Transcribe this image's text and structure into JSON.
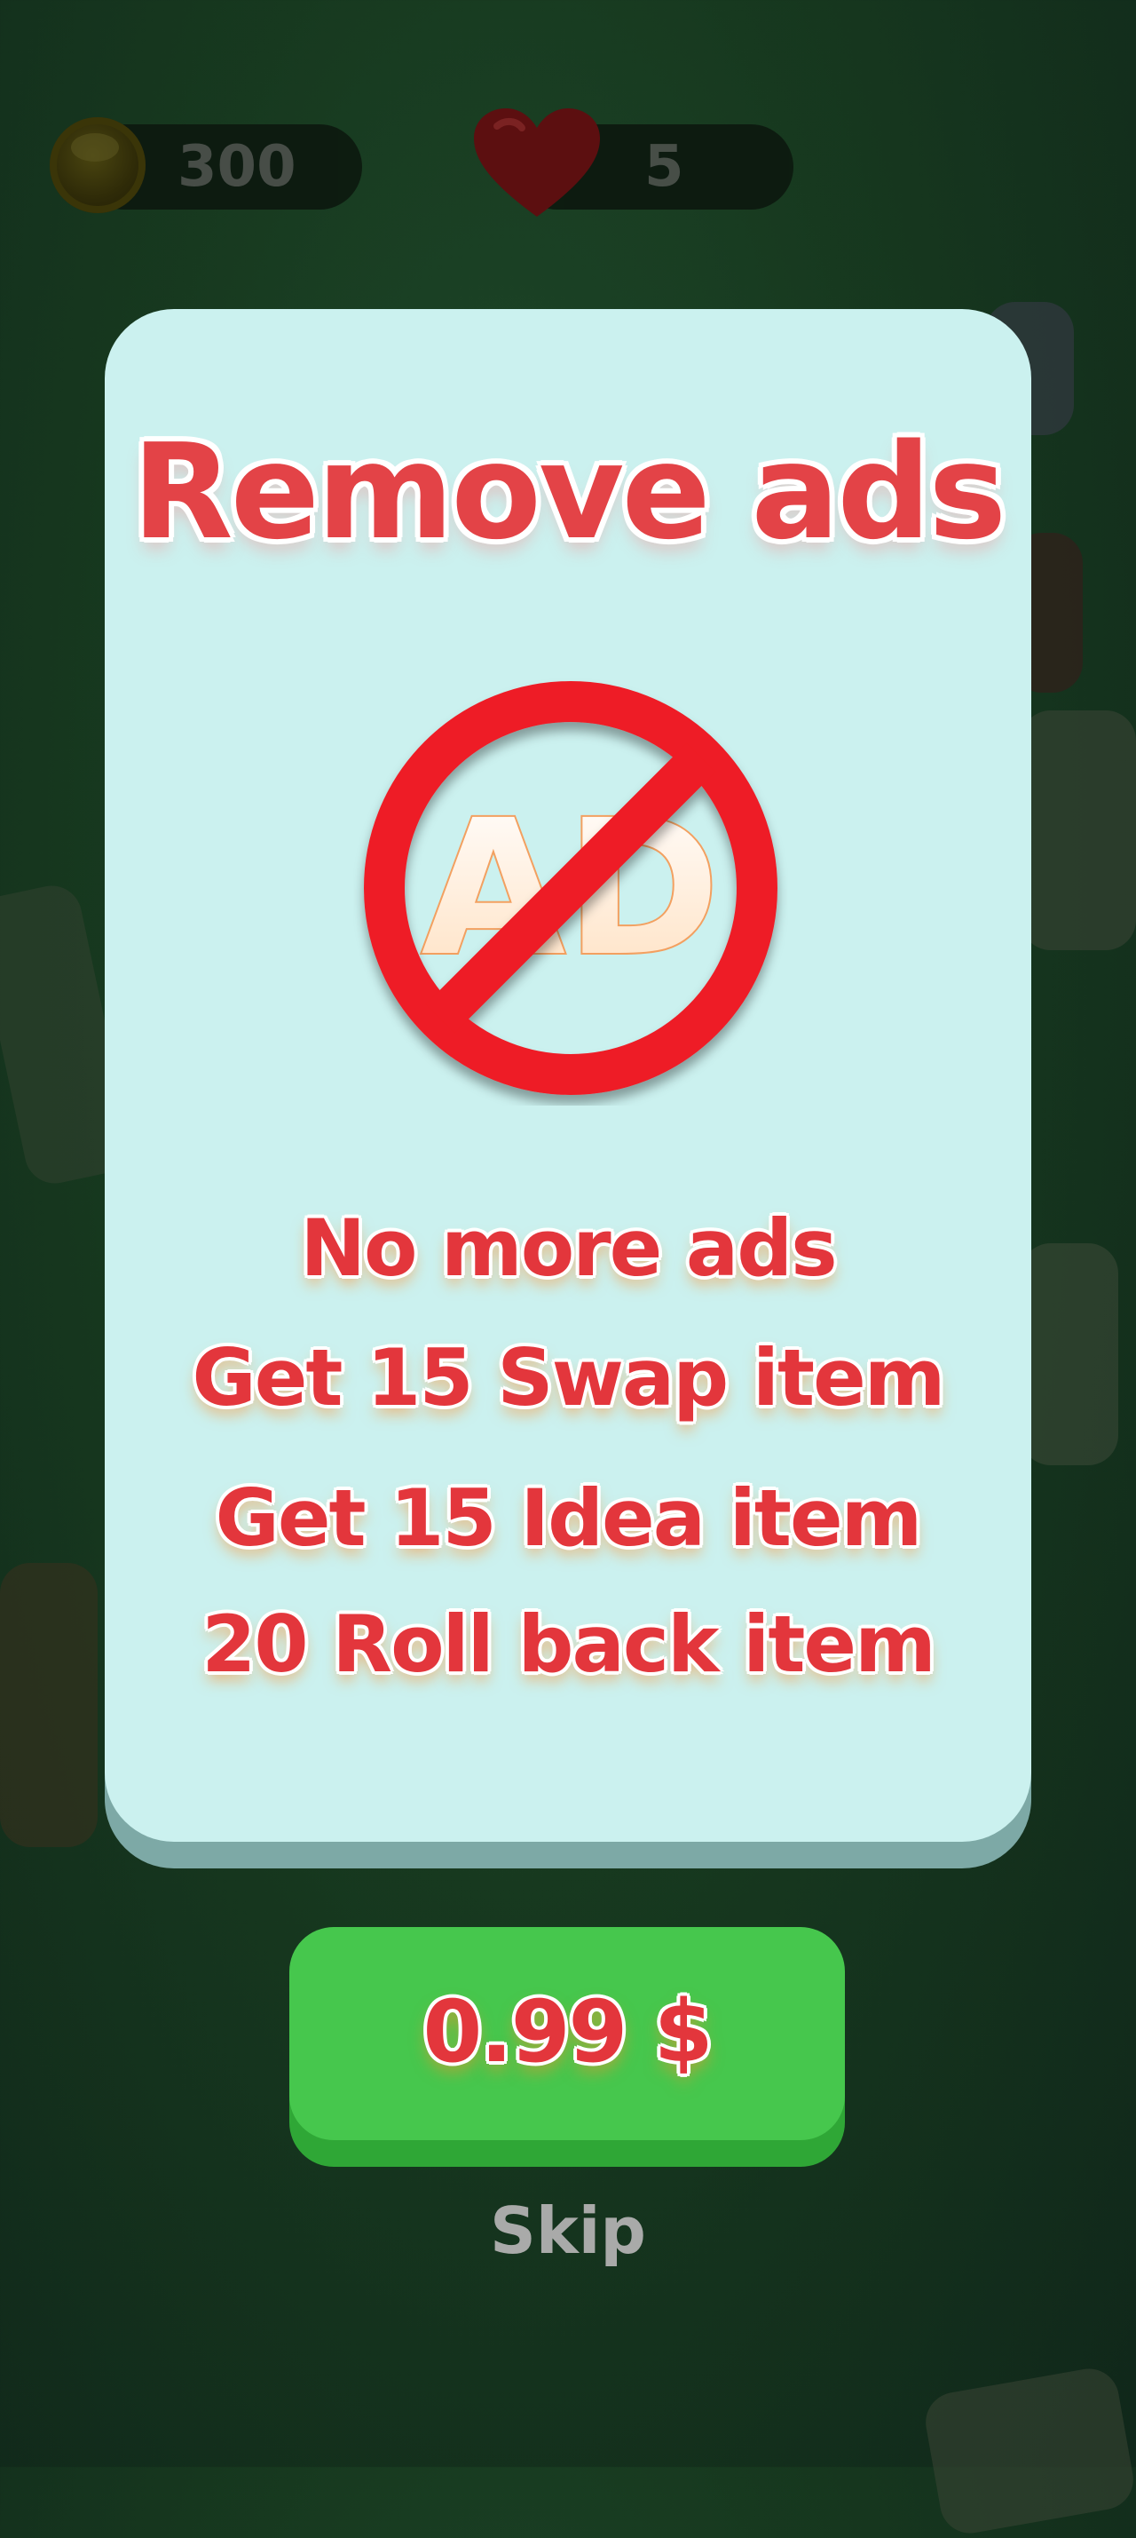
{
  "hud": {
    "coins": "300",
    "lives": "5"
  },
  "modal": {
    "title": "Remove ads",
    "icon": "no-ads-icon",
    "icon_text": "AD",
    "features": [
      "No more ads",
      "Get 15 Swap item",
      "Get 15 Idea item",
      "20 Roll back item"
    ],
    "price_label": "0.99 $",
    "skip_label": "Skip"
  },
  "colors": {
    "accent_red": "#e3363c",
    "card_bg": "#cbf1ef",
    "buy_green": "#46c74d",
    "background": "#17391f"
  }
}
